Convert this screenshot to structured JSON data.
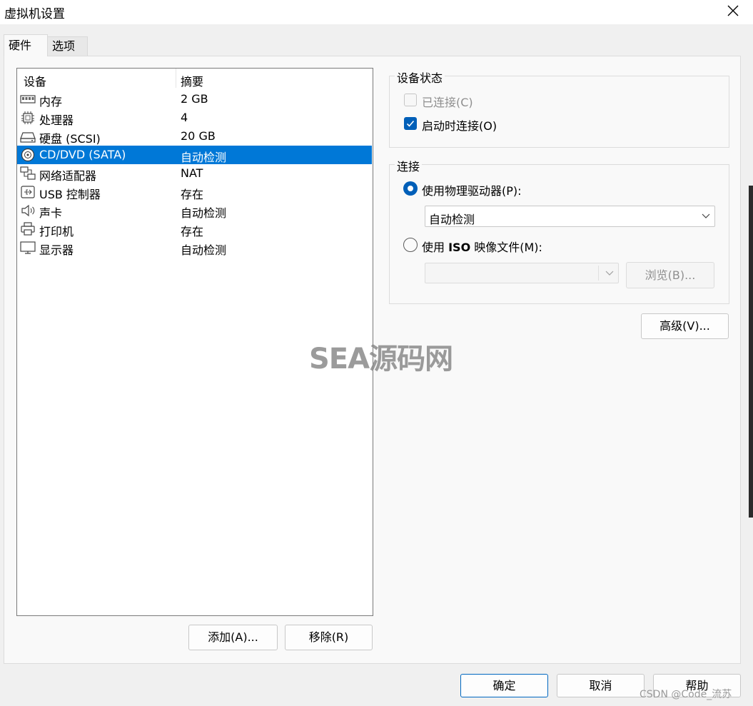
{
  "window": {
    "title": "虚拟机设置"
  },
  "tabs": [
    {
      "label": "硬件",
      "active": true
    },
    {
      "label": "选项",
      "active": false
    }
  ],
  "device_list": {
    "columns": {
      "device": "设备",
      "summary": "摘要"
    },
    "rows": [
      {
        "name": "内存",
        "summary": "2 GB",
        "icon": "memory-icon",
        "selected": false
      },
      {
        "name": "处理器",
        "summary": "4",
        "icon": "processor-icon",
        "selected": false
      },
      {
        "name": "硬盘 (SCSI)",
        "summary": "20 GB",
        "icon": "hard-disk-icon",
        "selected": false
      },
      {
        "name": "CD/DVD (SATA)",
        "summary": "自动检测",
        "icon": "cd-dvd-icon",
        "selected": true
      },
      {
        "name": "网络适配器",
        "summary": "NAT",
        "icon": "network-adapter-icon",
        "selected": false
      },
      {
        "name": "USB 控制器",
        "summary": "存在",
        "icon": "usb-icon",
        "selected": false
      },
      {
        "name": "声卡",
        "summary": "自动检测",
        "icon": "speaker-icon",
        "selected": false
      },
      {
        "name": "打印机",
        "summary": "存在",
        "icon": "printer-icon",
        "selected": false
      },
      {
        "name": "显示器",
        "summary": "自动检测",
        "icon": "monitor-icon",
        "selected": false
      }
    ],
    "add_button": "添加(A)...",
    "remove_button": "移除(R)"
  },
  "device_status": {
    "label": "设备状态",
    "connected": {
      "label": "已连接(C)",
      "checked": false,
      "disabled": true
    },
    "connect_at_power_on": {
      "label": "启动时连接(O)",
      "checked": true,
      "disabled": false
    }
  },
  "connection": {
    "label": "连接",
    "physical_drive": {
      "label": "使用物理驱动器(P):",
      "selected": true,
      "value": "自动检测"
    },
    "iso_image": {
      "label_prefix": "使用 ",
      "label_bold": "ISO",
      "label_suffix": " 映像文件(M):",
      "selected": false,
      "value": ""
    },
    "browse_button": "浏览(B)..."
  },
  "advanced_button": "高级(V)...",
  "footer": {
    "ok": "确定",
    "cancel": "取消",
    "help": "帮助"
  },
  "watermarks": {
    "center": "SEA源码网",
    "corner": "CSDN @Code_流苏"
  },
  "colors": {
    "selection": "#0078d7",
    "accent": "#005fb8"
  }
}
